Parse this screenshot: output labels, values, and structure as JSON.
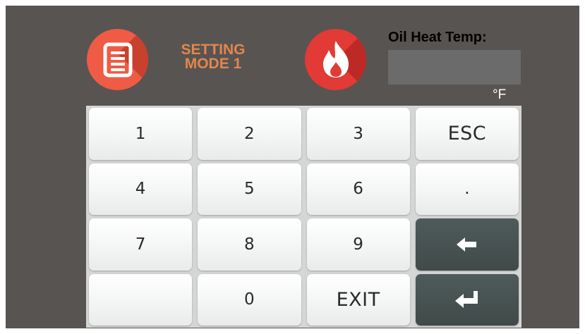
{
  "header": {
    "setting_icon": "document-list-icon",
    "setting_label_line1": "SETTING",
    "setting_label_line2": "MODE 1",
    "flame_icon": "flame-icon",
    "temp_label": "Oil Heat Temp:",
    "temp_value": "",
    "unit": "°F"
  },
  "keypad": {
    "key_1": "1",
    "key_2": "2",
    "key_3": "3",
    "key_esc": "ESC",
    "key_4": "4",
    "key_5": "5",
    "key_6": "6",
    "key_dot": ".",
    "key_7": "7",
    "key_8": "8",
    "key_9": "9",
    "key_backspace_icon": "arrow-left-icon",
    "key_blank": "",
    "key_0": "0",
    "key_exit": "EXIT",
    "key_enter_icon": "enter-return-icon"
  },
  "colors": {
    "panel_background": "#585452",
    "setting_icon_color": "#ef5b44",
    "setting_label_color": "#e2864d",
    "flame_icon_color": "#e23a35",
    "temp_field_background": "#6b6b6b",
    "dark_key_color": "#45504f"
  }
}
